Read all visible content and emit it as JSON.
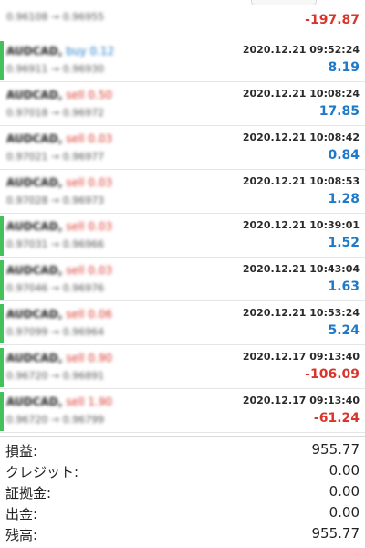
{
  "colors": {
    "accent_green": "#45c15b",
    "profit_blue": "#1e79c8",
    "loss_red": "#d9362b"
  },
  "top_row": {
    "prices": "0.96108 → 0.96955",
    "pl": "-197.87"
  },
  "trades": [
    {
      "symbol": "AUDCAD",
      "direction": "buy 0.12",
      "prices": "0.96911 → 0.96930",
      "time": "2020.12.21 09:52:24",
      "pl": "8.19",
      "sign": "pos",
      "dir_color": "#1e79c8",
      "bar": true
    },
    {
      "symbol": "AUDCAD",
      "direction": "sell 0.50",
      "prices": "0.97018 → 0.96972",
      "time": "2020.12.21 10:08:24",
      "pl": "17.85",
      "sign": "pos",
      "dir_color": "#d9362b",
      "bar": false
    },
    {
      "symbol": "AUDCAD",
      "direction": "sell 0.03",
      "prices": "0.97021 → 0.96977",
      "time": "2020.12.21 10:08:42",
      "pl": "0.84",
      "sign": "pos",
      "dir_color": "#d9362b",
      "bar": false
    },
    {
      "symbol": "AUDCAD",
      "direction": "sell 0.03",
      "prices": "0.97028 → 0.96973",
      "time": "2020.12.21 10:08:53",
      "pl": "1.28",
      "sign": "pos",
      "dir_color": "#d9362b",
      "bar": false
    },
    {
      "symbol": "AUDCAD",
      "direction": "sell 0.03",
      "prices": "0.97031 → 0.96966",
      "time": "2020.12.21 10:39:01",
      "pl": "1.52",
      "sign": "pos",
      "dir_color": "#d9362b",
      "bar": true
    },
    {
      "symbol": "AUDCAD",
      "direction": "sell 0.03",
      "prices": "0.97046 → 0.96976",
      "time": "2020.12.21 10:43:04",
      "pl": "1.63",
      "sign": "pos",
      "dir_color": "#d9362b",
      "bar": true
    },
    {
      "symbol": "AUDCAD",
      "direction": "sell 0.06",
      "prices": "0.97099 → 0.96964",
      "time": "2020.12.21 10:53:24",
      "pl": "5.24",
      "sign": "pos",
      "dir_color": "#d9362b",
      "bar": true
    },
    {
      "symbol": "AUDCAD",
      "direction": "sell 0.90",
      "prices": "0.96720 → 0.96891",
      "time": "2020.12.17 09:13:40",
      "pl": "-106.09",
      "sign": "neg",
      "dir_color": "#d9362b",
      "bar": true
    },
    {
      "symbol": "AUDCAD",
      "direction": "sell 1.90",
      "prices": "0.96720 → 0.96799",
      "time": "2020.12.17 09:13:40",
      "pl": "-61.24",
      "sign": "neg",
      "dir_color": "#d9362b",
      "bar": true
    }
  ],
  "summary": [
    {
      "label": "損益:",
      "value": "955.77"
    },
    {
      "label": "クレジット:",
      "value": "0.00"
    },
    {
      "label": "証拠金:",
      "value": "0.00"
    },
    {
      "label": "出金:",
      "value": "0.00"
    },
    {
      "label": "残高:",
      "value": "955.77"
    }
  ]
}
